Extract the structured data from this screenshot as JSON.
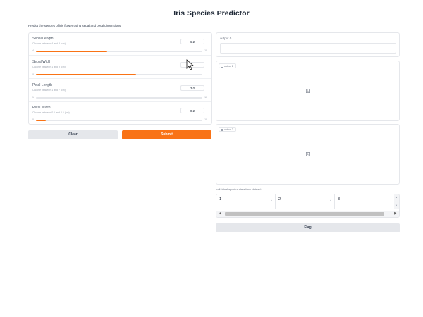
{
  "app": {
    "title": "Iris Species Predictor",
    "description": "Predict the species of iris flower using sepal and petal dimensions."
  },
  "sliders": [
    {
      "label": "Sepal Length",
      "info": "Choose between 4 and 8 (cm)",
      "value": "6.2",
      "min": "4",
      "max": "10",
      "fill_fraction": 0.43
    },
    {
      "label": "Sepal Width",
      "info": "Choose between 1 and 9 (cm)",
      "value": "",
      "min": "1",
      "max": "",
      "fill_fraction": 0.6
    },
    {
      "label": "Petal Length",
      "info": "Choose between 1 and 7 (cm)",
      "value": "3.0",
      "min": "1",
      "max": "10",
      "fill_fraction": 0.0
    },
    {
      "label": "Petal Width",
      "info": "Choose between 0.1 and 2.5 (cm)",
      "value": "0.2",
      "min": "0",
      "max": "10",
      "fill_fraction": 0.06
    }
  ],
  "buttons": {
    "clear": "Clear",
    "submit": "Submit",
    "flag": "Flag"
  },
  "outputs": {
    "text_label": "output 0",
    "image1_label": "output 1",
    "image2_label": "output 2"
  },
  "dataframe": {
    "label": "Individual species stats from dataset",
    "columns": [
      "1",
      "2",
      "3"
    ]
  },
  "colors": {
    "accent": "#f97316",
    "neutral_button": "#e5e7eb"
  },
  "icons": {
    "reset": "reset-icon",
    "image_placeholder": "image-icon",
    "sort": "sort-arrow-icon"
  }
}
